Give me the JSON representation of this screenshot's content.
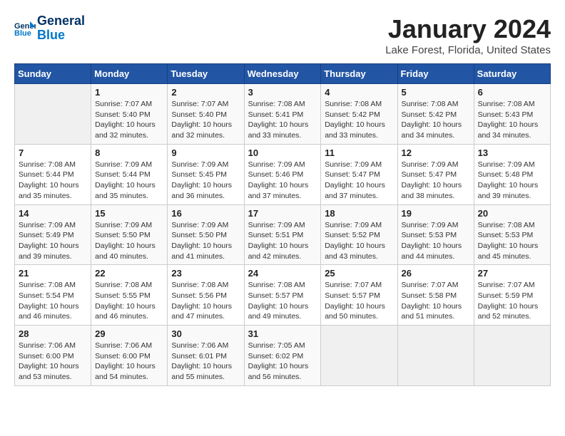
{
  "header": {
    "logo_line1": "General",
    "logo_line2": "Blue",
    "title": "January 2024",
    "subtitle": "Lake Forest, Florida, United States"
  },
  "days_of_week": [
    "Sunday",
    "Monday",
    "Tuesday",
    "Wednesday",
    "Thursday",
    "Friday",
    "Saturday"
  ],
  "weeks": [
    [
      {
        "day": "",
        "empty": true
      },
      {
        "day": "1",
        "sunrise": "7:07 AM",
        "sunset": "5:40 PM",
        "daylight": "10 hours and 32 minutes."
      },
      {
        "day": "2",
        "sunrise": "7:07 AM",
        "sunset": "5:40 PM",
        "daylight": "10 hours and 32 minutes."
      },
      {
        "day": "3",
        "sunrise": "7:08 AM",
        "sunset": "5:41 PM",
        "daylight": "10 hours and 33 minutes."
      },
      {
        "day": "4",
        "sunrise": "7:08 AM",
        "sunset": "5:42 PM",
        "daylight": "10 hours and 33 minutes."
      },
      {
        "day": "5",
        "sunrise": "7:08 AM",
        "sunset": "5:42 PM",
        "daylight": "10 hours and 34 minutes."
      },
      {
        "day": "6",
        "sunrise": "7:08 AM",
        "sunset": "5:43 PM",
        "daylight": "10 hours and 34 minutes."
      }
    ],
    [
      {
        "day": "7",
        "sunrise": "7:08 AM",
        "sunset": "5:44 PM",
        "daylight": "10 hours and 35 minutes."
      },
      {
        "day": "8",
        "sunrise": "7:09 AM",
        "sunset": "5:44 PM",
        "daylight": "10 hours and 35 minutes."
      },
      {
        "day": "9",
        "sunrise": "7:09 AM",
        "sunset": "5:45 PM",
        "daylight": "10 hours and 36 minutes."
      },
      {
        "day": "10",
        "sunrise": "7:09 AM",
        "sunset": "5:46 PM",
        "daylight": "10 hours and 37 minutes."
      },
      {
        "day": "11",
        "sunrise": "7:09 AM",
        "sunset": "5:47 PM",
        "daylight": "10 hours and 37 minutes."
      },
      {
        "day": "12",
        "sunrise": "7:09 AM",
        "sunset": "5:47 PM",
        "daylight": "10 hours and 38 minutes."
      },
      {
        "day": "13",
        "sunrise": "7:09 AM",
        "sunset": "5:48 PM",
        "daylight": "10 hours and 39 minutes."
      }
    ],
    [
      {
        "day": "14",
        "sunrise": "7:09 AM",
        "sunset": "5:49 PM",
        "daylight": "10 hours and 39 minutes."
      },
      {
        "day": "15",
        "sunrise": "7:09 AM",
        "sunset": "5:50 PM",
        "daylight": "10 hours and 40 minutes."
      },
      {
        "day": "16",
        "sunrise": "7:09 AM",
        "sunset": "5:50 PM",
        "daylight": "10 hours and 41 minutes."
      },
      {
        "day": "17",
        "sunrise": "7:09 AM",
        "sunset": "5:51 PM",
        "daylight": "10 hours and 42 minutes."
      },
      {
        "day": "18",
        "sunrise": "7:09 AM",
        "sunset": "5:52 PM",
        "daylight": "10 hours and 43 minutes."
      },
      {
        "day": "19",
        "sunrise": "7:09 AM",
        "sunset": "5:53 PM",
        "daylight": "10 hours and 44 minutes."
      },
      {
        "day": "20",
        "sunrise": "7:08 AM",
        "sunset": "5:53 PM",
        "daylight": "10 hours and 45 minutes."
      }
    ],
    [
      {
        "day": "21",
        "sunrise": "7:08 AM",
        "sunset": "5:54 PM",
        "daylight": "10 hours and 46 minutes."
      },
      {
        "day": "22",
        "sunrise": "7:08 AM",
        "sunset": "5:55 PM",
        "daylight": "10 hours and 46 minutes."
      },
      {
        "day": "23",
        "sunrise": "7:08 AM",
        "sunset": "5:56 PM",
        "daylight": "10 hours and 47 minutes."
      },
      {
        "day": "24",
        "sunrise": "7:08 AM",
        "sunset": "5:57 PM",
        "daylight": "10 hours and 49 minutes."
      },
      {
        "day": "25",
        "sunrise": "7:07 AM",
        "sunset": "5:57 PM",
        "daylight": "10 hours and 50 minutes."
      },
      {
        "day": "26",
        "sunrise": "7:07 AM",
        "sunset": "5:58 PM",
        "daylight": "10 hours and 51 minutes."
      },
      {
        "day": "27",
        "sunrise": "7:07 AM",
        "sunset": "5:59 PM",
        "daylight": "10 hours and 52 minutes."
      }
    ],
    [
      {
        "day": "28",
        "sunrise": "7:06 AM",
        "sunset": "6:00 PM",
        "daylight": "10 hours and 53 minutes."
      },
      {
        "day": "29",
        "sunrise": "7:06 AM",
        "sunset": "6:00 PM",
        "daylight": "10 hours and 54 minutes."
      },
      {
        "day": "30",
        "sunrise": "7:06 AM",
        "sunset": "6:01 PM",
        "daylight": "10 hours and 55 minutes."
      },
      {
        "day": "31",
        "sunrise": "7:05 AM",
        "sunset": "6:02 PM",
        "daylight": "10 hours and 56 minutes."
      },
      {
        "day": "",
        "empty": true
      },
      {
        "day": "",
        "empty": true
      },
      {
        "day": "",
        "empty": true
      }
    ]
  ],
  "labels": {
    "sunrise_label": "Sunrise:",
    "sunset_label": "Sunset:",
    "daylight_label": "Daylight:"
  }
}
